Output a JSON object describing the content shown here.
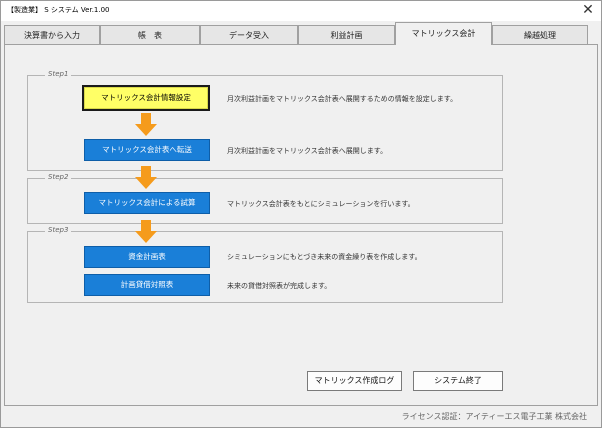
{
  "window": {
    "title": "【製造業】 S システム Ver.1.00",
    "close_symbol": "✕"
  },
  "tabs": [
    {
      "label": "決算書から入力"
    },
    {
      "label": "帳　表"
    },
    {
      "label": "データ受入"
    },
    {
      "label": "利益計画"
    },
    {
      "label": "マトリックス会計"
    },
    {
      "label": "繰越処理"
    }
  ],
  "active_tab": "マトリックス会計",
  "steps": [
    {
      "label": "Step1"
    },
    {
      "label": "Step2"
    },
    {
      "label": "Step3"
    }
  ],
  "actions": {
    "matrix_setup": {
      "label": "マトリックス会計情報設定",
      "desc": "月次利益計画をマトリックス会計表へ展開するための情報を設定します。"
    },
    "matrix_transfer": {
      "label": "マトリックス会計表へ転送",
      "desc": "月次利益計画をマトリックス会計表へ展開します。"
    },
    "matrix_trial": {
      "label": "マトリックス会計による試算",
      "desc": "マトリックス会計表をもとにシミュレーションを行います。"
    },
    "funds_plan": {
      "label": "資金計画表",
      "desc": "シミュレーションにもとづき未来の資金繰り表を作成します。"
    },
    "balance_plan": {
      "label": "計画貸借対照表",
      "desc": "未来の貸借対照表が完成します。"
    }
  },
  "footer": {
    "log_label": "マトリックス作成ログ",
    "exit_label": "システム終了",
    "license": "ライセンス認証：アイティーエス電子工業 株式会社"
  },
  "colors": {
    "accent_blue": "#1a7fd8",
    "highlight_yellow": "#ffff66",
    "arrow_orange": "#f59b1c"
  },
  "icons": {
    "flow_arrow": "down-arrow-icon",
    "close": "close-icon"
  }
}
